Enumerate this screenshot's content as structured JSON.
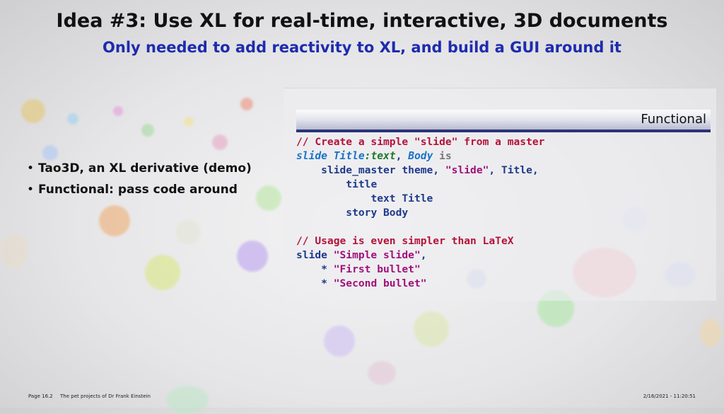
{
  "slide": {
    "title": "Idea #3: Use XL for real-time, interactive, 3D documents",
    "subtitle": "Only needed to add reactivity to XL, and build a GUI around it"
  },
  "bullets": [
    "Tao3D, an XL derivative (demo)",
    "Functional: pass code around"
  ],
  "code_panel": {
    "header_label": "Functional",
    "lines": {
      "l1": "// Create a simple \"slide\" from a master",
      "l2_slide": "slide",
      "l2_title": "Title",
      "l2_colon": ":",
      "l2_text": "text",
      "l2_comma": ",",
      "l2_body": "Body",
      "l2_is": "is",
      "l3_master": "slide_master theme, ",
      "l3_str": "\"slide\"",
      "l3_rest": ", Title,",
      "l4": "title",
      "l5": "text Title",
      "l6": "story Body",
      "l8": "// Usage is even simpler than LaTeX",
      "l9_slide": "slide ",
      "l9_str": "\"Simple slide\"",
      "l9_comma": ",",
      "l10_star": "* ",
      "l10_str": "\"First bullet\"",
      "l11_star": "* ",
      "l11_str": "\"Second bullet\""
    }
  },
  "footer": {
    "page": "Page 16.2",
    "title": "The pet projects of Dr Frank Einstein",
    "datetime": "2/16/2021 - 11:20:51"
  }
}
